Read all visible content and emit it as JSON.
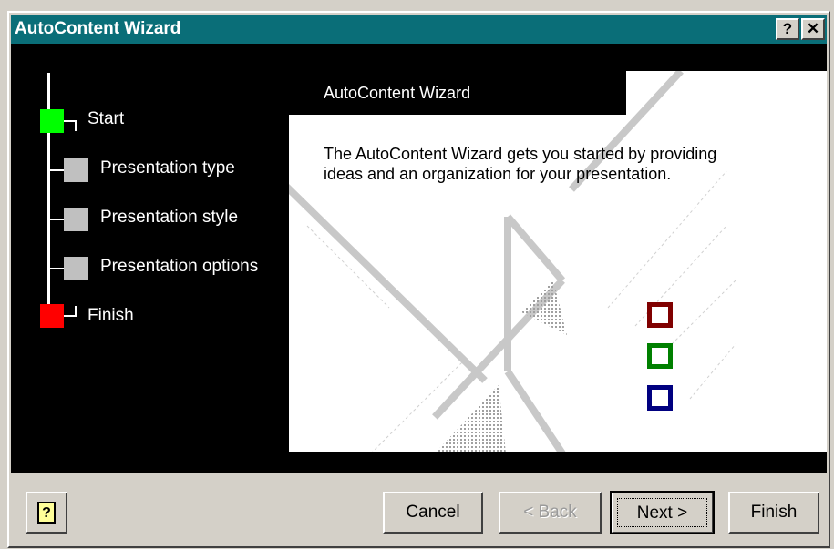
{
  "window": {
    "title": "AutoContent Wizard",
    "help_glyph": "?",
    "close_glyph": "✕"
  },
  "roadmap": {
    "steps": [
      {
        "label": "Start",
        "color": "#00ff00"
      },
      {
        "label": "Presentation type",
        "color": "#c0c0c0"
      },
      {
        "label": "Presentation style",
        "color": "#c0c0c0"
      },
      {
        "label": "Presentation options",
        "color": "#c0c0c0"
      },
      {
        "label": "Finish",
        "color": "#ff0000"
      }
    ]
  },
  "panel": {
    "heading": "AutoContent Wizard",
    "description": "The AutoContent Wizard gets you started by providing ideas and an organization for your presentation.",
    "decor_squares": [
      {
        "color": "#800000"
      },
      {
        "color": "#008000"
      },
      {
        "color": "#000080"
      }
    ]
  },
  "buttons": {
    "cancel": "Cancel",
    "back": "< Back",
    "next": "Next >",
    "finish": "Finish",
    "help_icon": "?"
  }
}
